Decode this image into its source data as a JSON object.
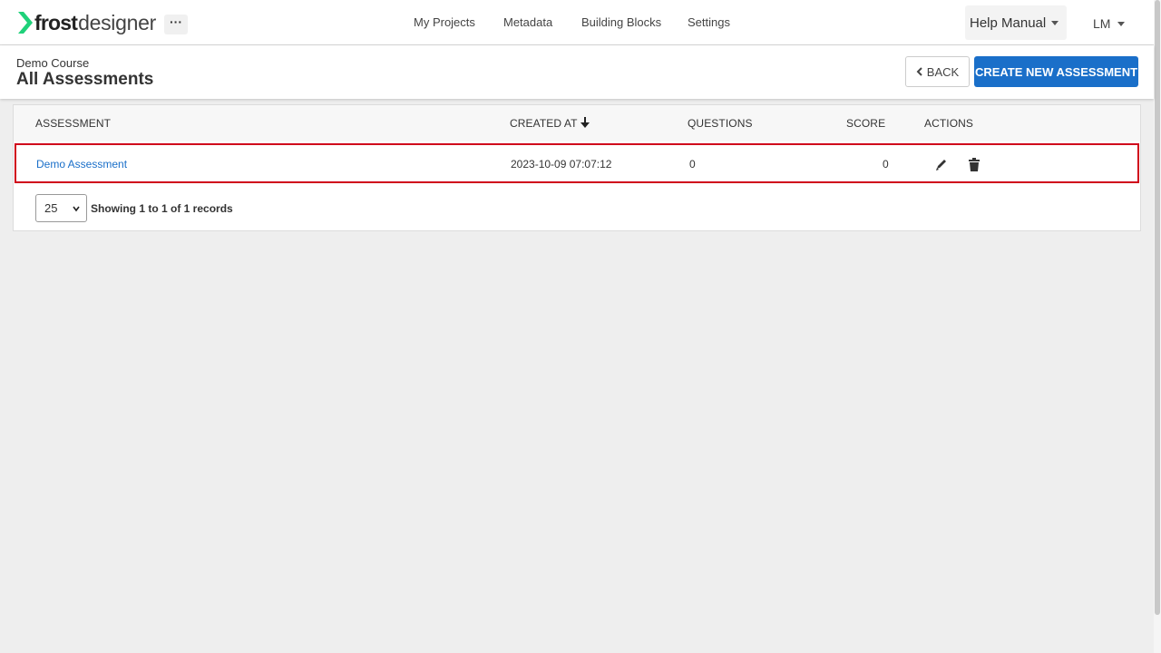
{
  "brand": {
    "part1": "frost",
    "part2": "designer",
    "accent_color": "#1fd17a"
  },
  "navbar": {
    "more_label": "···",
    "links": [
      "My Projects",
      "Metadata",
      "Building Blocks",
      "Settings"
    ],
    "help_label": "Help Manual",
    "user_label": "LM"
  },
  "header": {
    "breadcrumb": "Demo Course",
    "title": "All Assessments",
    "back_label": "BACK",
    "create_label": "CREATE NEW ASSESSMENT",
    "primary_color": "#1a6fc9"
  },
  "table": {
    "columns": [
      "ASSESSMENT",
      "CREATED AT",
      "QUESTIONS",
      "SCORE",
      "ACTIONS"
    ],
    "sorted_column": "CREATED AT",
    "sort_direction": "desc",
    "rows": [
      {
        "assessment": "Demo Assessment",
        "created_at": "2023-10-09 07:07:12",
        "questions": "0",
        "score": "0",
        "actions": [
          "pencil-icon",
          "trash-icon"
        ]
      }
    ],
    "highlight_color": "#d0021b"
  },
  "pagination": {
    "page_size": "25",
    "summary": "Showing 1 to 1 of 1 records"
  }
}
